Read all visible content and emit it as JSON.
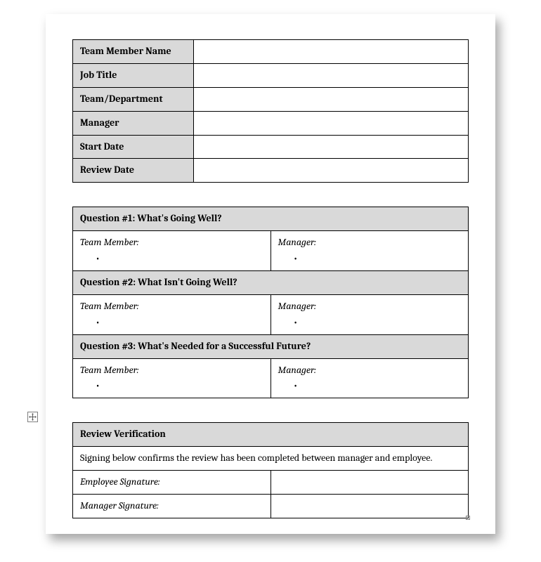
{
  "info_rows": [
    {
      "label": "Team Member Name",
      "value": ""
    },
    {
      "label": "Job Title",
      "value": ""
    },
    {
      "label": "Team/Department",
      "value": ""
    },
    {
      "label": "Manager",
      "value": ""
    },
    {
      "label": "Start Date",
      "value": ""
    },
    {
      "label": "Review Date",
      "value": ""
    }
  ],
  "questions": [
    {
      "title": "Question #1: What's Going Well?",
      "left_label": "Team Member:",
      "right_label": "Manager:",
      "bullet": "•"
    },
    {
      "title": "Question #2: What Isn't Going Well?",
      "left_label": "Team Member:",
      "right_label": "Manager:",
      "bullet": "•"
    },
    {
      "title": "Question #3: What's Needed for a Successful Future?",
      "left_label": "Team Member:",
      "right_label": "Manager:",
      "bullet": "•"
    }
  ],
  "verification": {
    "title": "Review Verification",
    "body": "Signing below confirms the review has been completed between manager and employee.",
    "employee_sig_label": "Employee Signature:",
    "manager_sig_label": "Manager Signature:"
  }
}
